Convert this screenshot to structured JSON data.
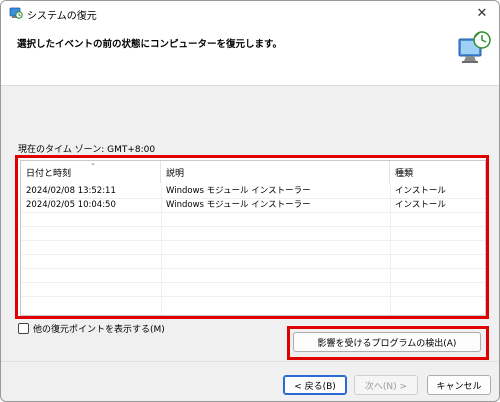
{
  "window": {
    "title": "システムの復元",
    "close_glyph": "✕"
  },
  "header": {
    "instruction": "選択したイベントの前の状態にコンピューターを復元します。"
  },
  "timezone_label": "現在のタイム ゾーン: GMT+8:00",
  "list": {
    "columns": [
      "日付と時刻",
      "説明",
      "種類"
    ],
    "rows": [
      {
        "date": "2024/02/08 13:52:11",
        "description": "Windows モジュール インストーラー",
        "type": "インストール"
      },
      {
        "date": "2024/02/05 10:04:50",
        "description": "Windows モジュール インストーラー",
        "type": "インストール"
      }
    ]
  },
  "show_more": {
    "label": "他の復元ポイントを表示する(M)",
    "checked": false
  },
  "scan_button": "影響を受けるプログラムの検出(A)",
  "buttons": {
    "back": "< 戻る(B)",
    "next": "次へ(N) >",
    "cancel": "キャンセル"
  },
  "colors": {
    "highlight_border": "#e00000",
    "default_button_border": "#2a6bd1"
  }
}
